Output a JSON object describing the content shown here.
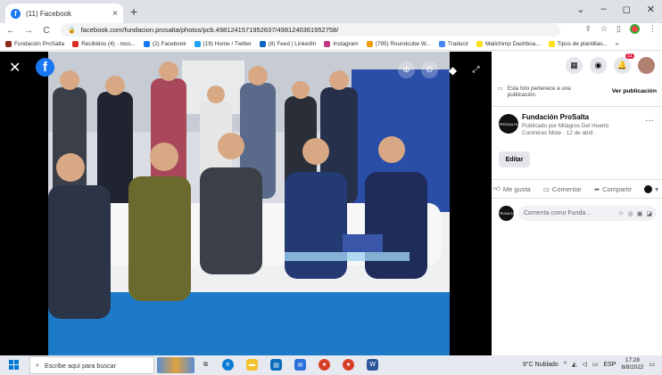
{
  "browser": {
    "tab_title": "(11) Facebook",
    "tab_close": "×",
    "new_tab": "+",
    "url": "facebook.com/fundacion.prosalta/photos/pcb.4981241571952637/4981240361952758/",
    "window_controls": [
      "⌄",
      "–",
      "◻",
      "✕"
    ]
  },
  "bookmarks": [
    {
      "label": "Fundación ProSalta",
      "color": "#8b2a1a"
    },
    {
      "label": "Recibidos (4) - mco...",
      "color": "#d93025"
    },
    {
      "label": "(2) Facebook",
      "color": "#1877f2"
    },
    {
      "label": "(19) Home / Twitter",
      "color": "#1da1f2"
    },
    {
      "label": "(8) Feed | LinkedIn",
      "color": "#0a66c2"
    },
    {
      "label": "Instagram",
      "color": "#c13584"
    },
    {
      "label": "(795) Roundcube W...",
      "color": "#f39c12"
    },
    {
      "label": "Traducir",
      "color": "#4285f4"
    },
    {
      "label": "Mailchimp Dashboa...",
      "color": "#ffe01b"
    },
    {
      "label": "Tipos de plantillas...",
      "color": "#ffe01b"
    },
    {
      "label": "»",
      "color": ""
    }
  ],
  "viewer": {
    "close_glyph": "✕",
    "fb_logo": "f"
  },
  "panel": {
    "belongs_text": "Esta foto pertenece a una publicación.",
    "view_post": "Ver publicación",
    "page_name": "Fundación ProSalta",
    "published_by": "Publicado por Milagros Del Huerto Contreras Mote",
    "published_date": "· 12 de abril ·",
    "more": "···",
    "edit_label": "Editar",
    "like_label": "Me gusta",
    "comment_label": "Comentar",
    "share_label": "Compartir",
    "comment_placeholder": "Comenta como Funda...",
    "notif_badge": "11",
    "page_avatar_text": "PROSALTA"
  },
  "taskbar": {
    "search_placeholder": "Escribe aquí para buscar",
    "weather": "9°C Nublado",
    "lang": "ESP",
    "time": "17:28",
    "date": "8/8/2022"
  }
}
